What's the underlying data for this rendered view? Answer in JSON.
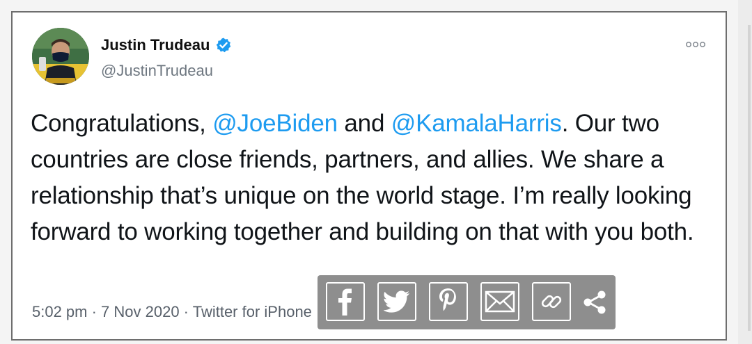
{
  "tweet": {
    "author_name": "Justin Trudeau",
    "handle": "@JustinTrudeau",
    "text": {
      "part1": "Congratulations, ",
      "mention1": "@JoeBiden",
      "part2": " and ",
      "mention2": "@KamalaHarris",
      "part3": ". Our two countries are close friends, partners, and allies. We share a relationship that’s unique on the world stage. I’m really looking forward to working together and building on that with you both."
    },
    "meta": "5:02 pm · 7 Nov 2020 · Twitter for iPhone"
  },
  "share_bar": {
    "buttons": [
      {
        "name": "facebook",
        "icon": "facebook-icon"
      },
      {
        "name": "twitter",
        "icon": "twitter-icon"
      },
      {
        "name": "pinterest",
        "icon": "pinterest-icon"
      },
      {
        "name": "email",
        "icon": "mail-icon"
      },
      {
        "name": "copy-link",
        "icon": "link-icon"
      },
      {
        "name": "share",
        "icon": "share-icon"
      }
    ]
  },
  "colors": {
    "mention": "#1d9bf0",
    "verified": "#1d9bf0",
    "share_bar_bg": "#8e8e8e"
  }
}
